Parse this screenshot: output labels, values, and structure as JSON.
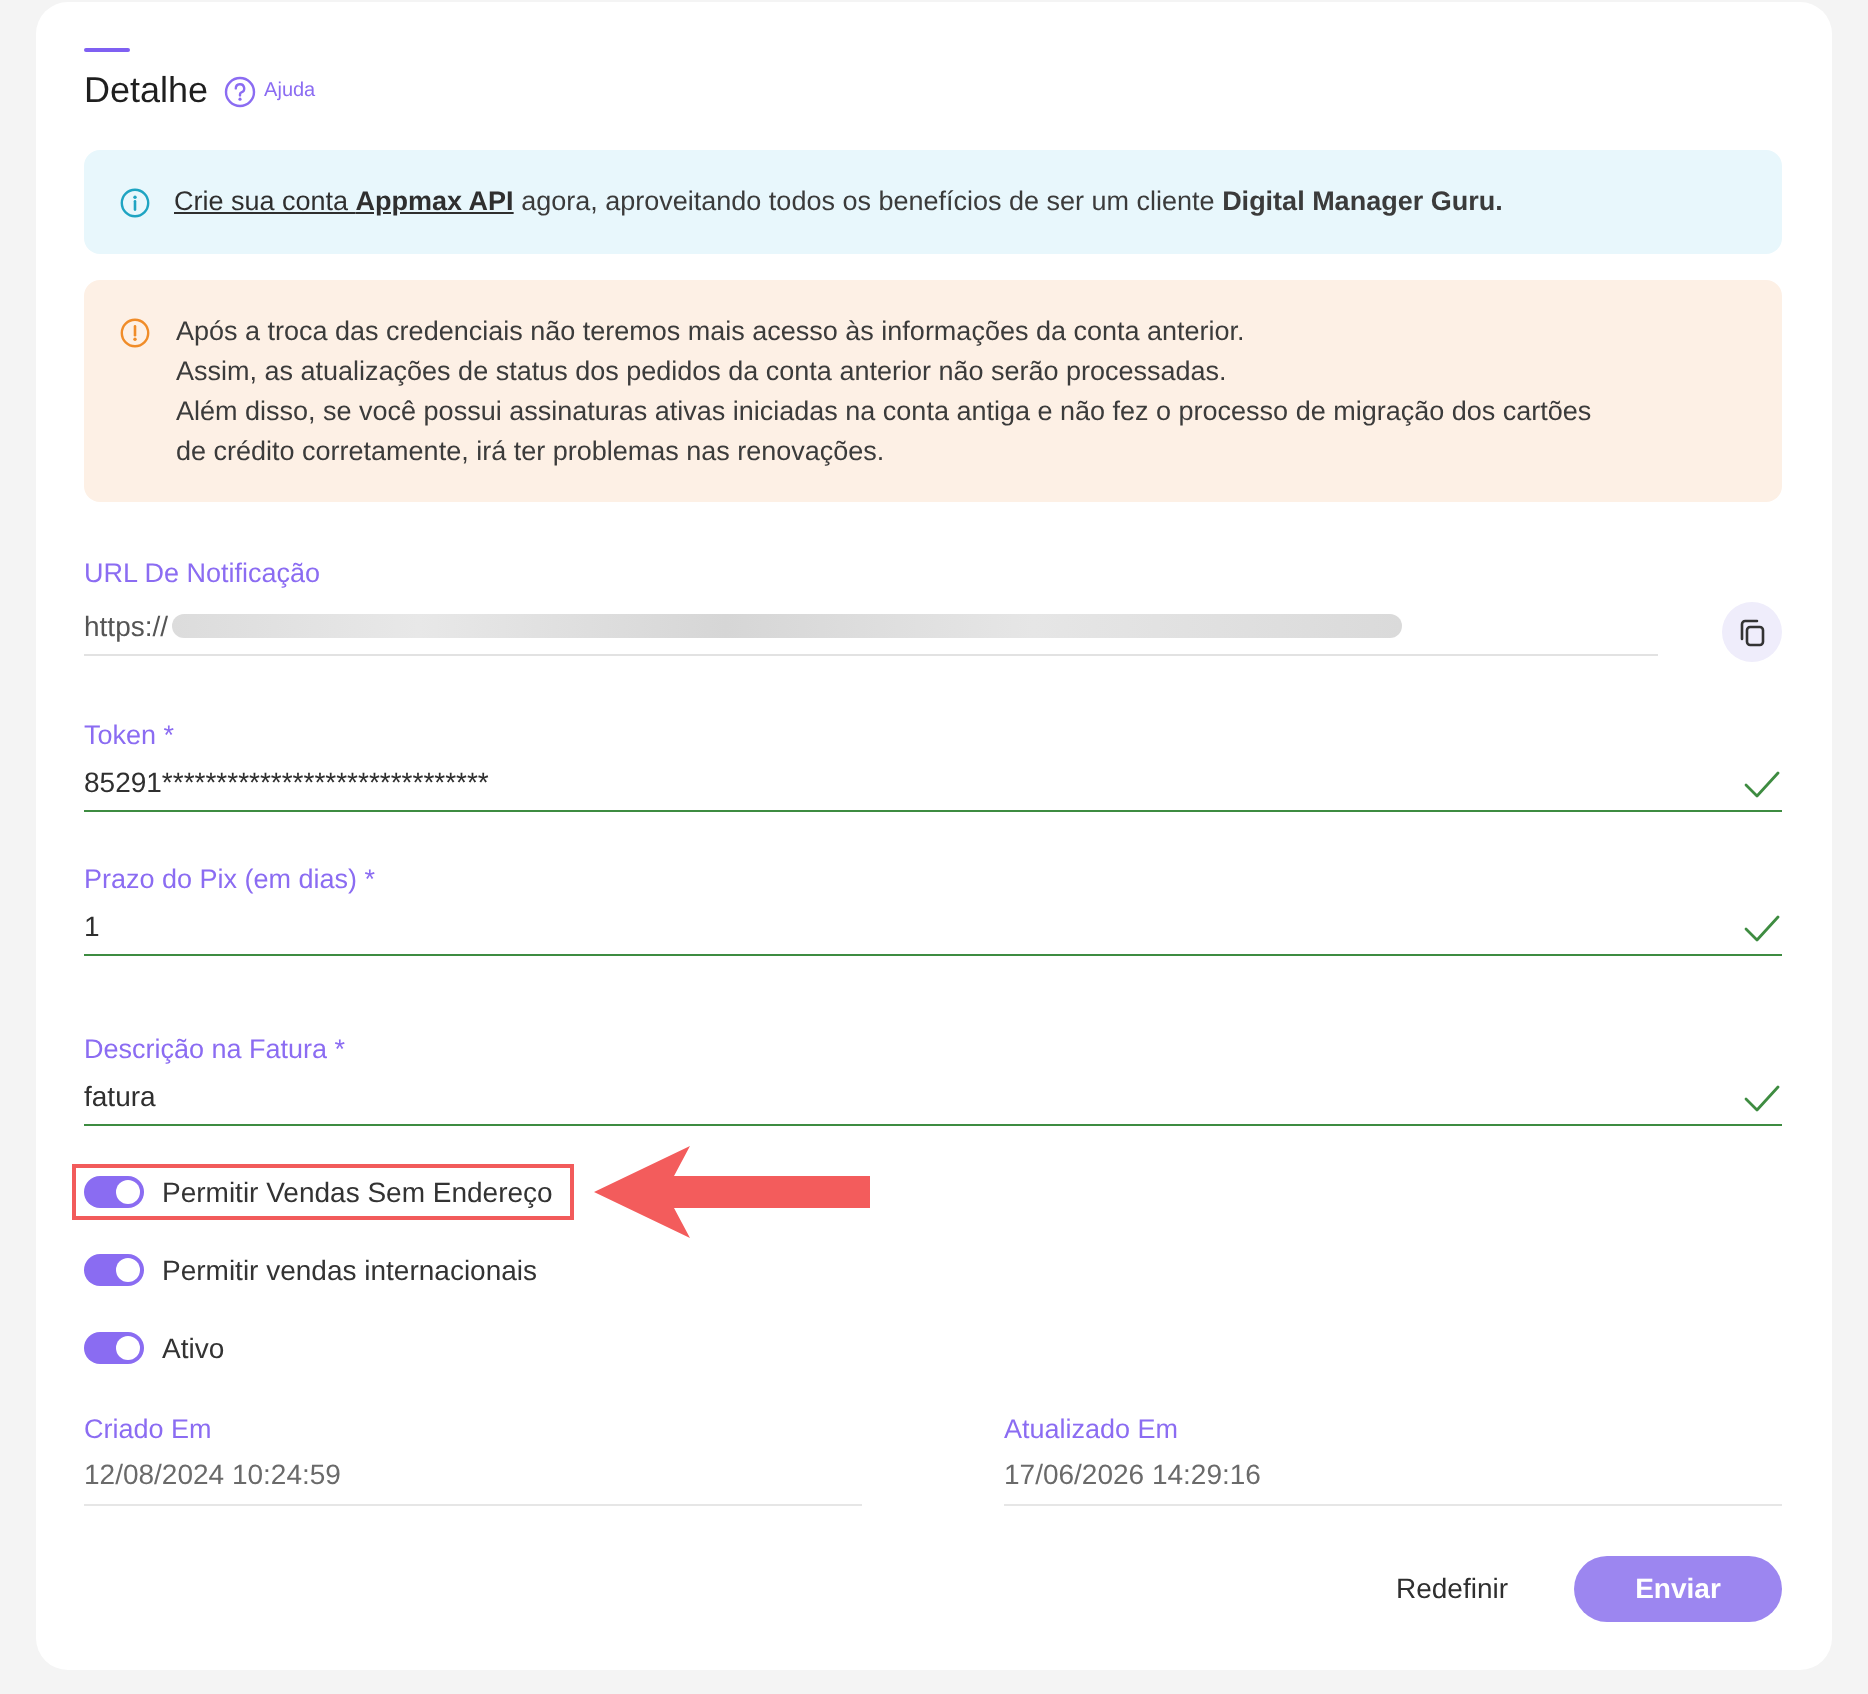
{
  "header": {
    "title": "Detalhe",
    "help_label": "Ajuda"
  },
  "alerts": [
    {
      "kind": "info",
      "link": "Crie sua conta **Appmax API**",
      "text": "agora, aproveitando todos os benefícios de ser um cliente **Digital Manager Guru.**"
    },
    {
      "kind": "warning",
      "lines": [
        "Após a troca das credenciais não teremos mais acesso às informações da conta anterior.",
        "Assim, as atualizações de status dos pedidos da conta anterior não serão processadas.",
        "Além disso, se você possui assinaturas ativas iniciadas na conta antiga e não fez o processo de migração dos cartões de crédito corretamente, irá ter problemas nas renovações."
      ]
    }
  ],
  "fields": [
    {
      "kind": "copyable",
      "label": "URL De Notificação",
      "value": "https://",
      "redacted": true,
      "valid": false
    },
    {
      "kind": "text",
      "label": "Token *",
      "value": "85291******************************",
      "valid": true
    },
    {
      "kind": "text",
      "label": "Prazo do Pix (em dias) *",
      "value": "1",
      "valid": true
    },
    {
      "kind": "text",
      "label": "Descrição na Fatura *",
      "value": "fatura",
      "valid": true
    }
  ],
  "toggles": [
    {
      "label": "Permitir Vendas Sem Endereço",
      "on": true,
      "highlighted": true
    },
    {
      "label": "Permitir vendas internacionais",
      "on": true,
      "highlighted": false
    },
    {
      "label": "Ativo",
      "on": true,
      "highlighted": false
    }
  ],
  "timestamps": [
    {
      "label": "Criado Em",
      "value": "12/08/2024 10:24:59"
    },
    {
      "label": "Atualizado Em",
      "value": "17/06/2026 14:29:16"
    }
  ],
  "buttons": [
    {
      "kind": "text",
      "label": "Redefinir",
      "disabled": false
    },
    {
      "kind": "primary",
      "label": "Enviar",
      "disabled": true
    }
  ]
}
